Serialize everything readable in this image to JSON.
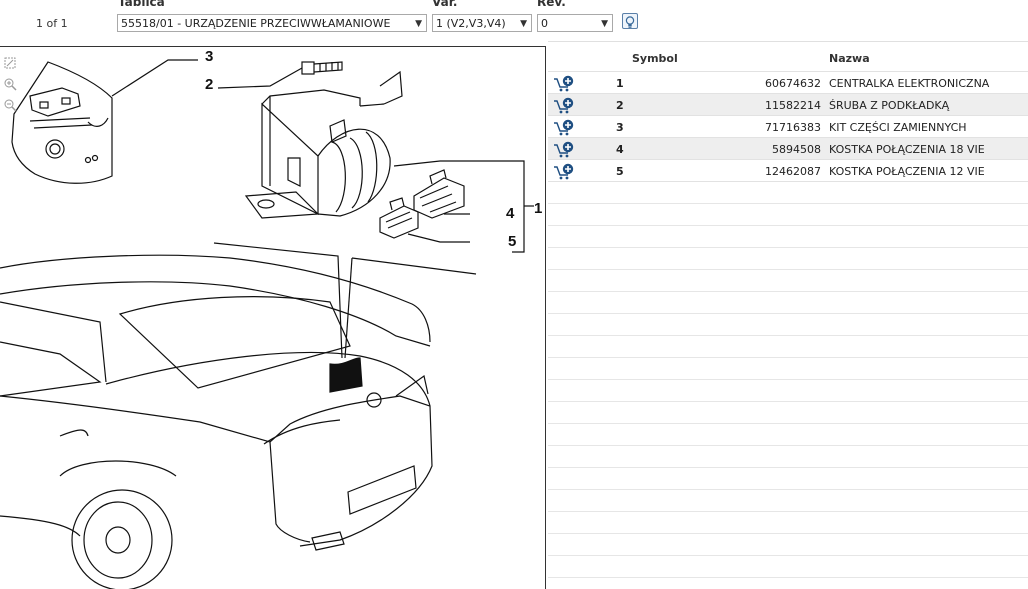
{
  "header": {
    "page_count": "1 of 1",
    "tablica_label": "Tablica",
    "var_label": "Var.",
    "rev_label": "Rev.",
    "tablica_value": "55518/01 - URZĄDZENIE PRZECIWWŁAMANIOWE",
    "var_value": "1 (V2,V3,V4)",
    "rev_value": "0"
  },
  "table": {
    "col_symbol": "Symbol",
    "col_nazwa": "Nazwa",
    "rows": [
      {
        "num": "1",
        "part": "60674632",
        "name": "CENTRALKA ELEKTRONICZNA"
      },
      {
        "num": "2",
        "part": "11582214",
        "name": "ŚRUBA Z PODKŁADKĄ"
      },
      {
        "num": "3",
        "part": "71716383",
        "name": "KIT CZĘŚCI ZAMIENNYCH"
      },
      {
        "num": "4",
        "part": "5894508",
        "name": "KOSTKA POŁĄCZENIA 18 VIE"
      },
      {
        "num": "5",
        "part": "12462087",
        "name": "KOSTKA POŁĄCZENIA 12 VIE"
      }
    ]
  },
  "diagram": {
    "callouts": [
      "1",
      "2",
      "3",
      "4",
      "5"
    ]
  },
  "icons": {
    "cart": "add-to-cart-icon",
    "bulb": "lightbulb-icon",
    "zoom_fit": "zoom-fit-icon",
    "zoom_in": "zoom-in-icon",
    "zoom_out": "zoom-out-icon"
  },
  "colors": {
    "cart_icon": "#1f4f82",
    "row_alt": "#eeeeee"
  }
}
